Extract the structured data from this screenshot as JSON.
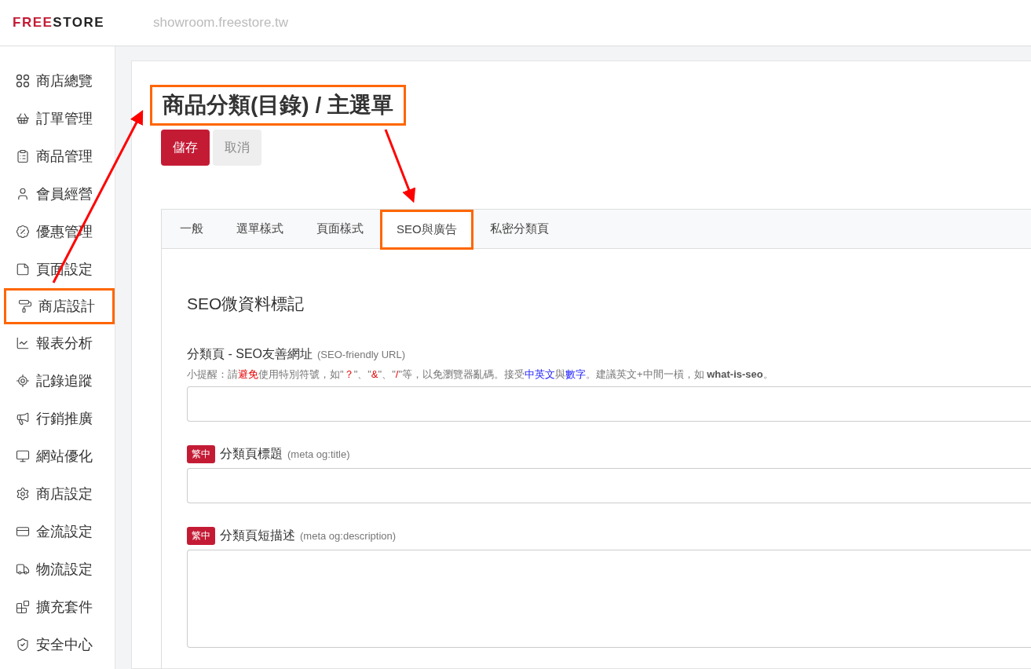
{
  "header": {
    "logo_red": "FREE",
    "logo_dark": "STORE",
    "domain": "showroom.freestore.tw"
  },
  "sidebar": {
    "items": [
      {
        "label": "商店總覽",
        "selected": false,
        "highlighted": false
      },
      {
        "label": "訂單管理",
        "selected": false,
        "highlighted": false
      },
      {
        "label": "商品管理",
        "selected": false,
        "highlighted": false
      },
      {
        "label": "會員經營",
        "selected": false,
        "highlighted": false
      },
      {
        "label": "優惠管理",
        "selected": false,
        "highlighted": false
      },
      {
        "label": "頁面設定",
        "selected": false,
        "highlighted": false
      },
      {
        "label": "商店設計",
        "selected": false,
        "highlighted": true
      },
      {
        "label": "報表分析",
        "selected": false,
        "highlighted": false
      },
      {
        "label": "記錄追蹤",
        "selected": false,
        "highlighted": false
      },
      {
        "label": "行銷推廣",
        "selected": false,
        "highlighted": false
      },
      {
        "label": "網站優化",
        "selected": false,
        "highlighted": false
      },
      {
        "label": "商店設定",
        "selected": false,
        "highlighted": false
      },
      {
        "label": "金流設定",
        "selected": false,
        "highlighted": false
      },
      {
        "label": "物流設定",
        "selected": false,
        "highlighted": false
      },
      {
        "label": "擴充套件",
        "selected": false,
        "highlighted": false
      },
      {
        "label": "安全中心",
        "selected": false,
        "highlighted": false
      }
    ]
  },
  "page": {
    "title": "商品分類(目錄) / 主選單",
    "title_highlighted": true,
    "buttons": [
      {
        "label": "儲存",
        "kind": "primary"
      },
      {
        "label": "取消",
        "kind": "secondary"
      }
    ],
    "tabs": [
      {
        "label": "一般",
        "selected": false,
        "highlighted": false
      },
      {
        "label": "選單樣式",
        "selected": false,
        "highlighted": false
      },
      {
        "label": "頁面樣式",
        "selected": false,
        "highlighted": false
      },
      {
        "label": "SEO與廣告",
        "selected": true,
        "highlighted": true
      },
      {
        "label": "私密分類頁",
        "selected": false,
        "highlighted": false
      }
    ],
    "section_title": "SEO微資料標記",
    "fields": [
      {
        "kind": "input",
        "label": "分類頁 - SEO友善網址",
        "note": "(SEO-friendly URL)",
        "hint": [
          {
            "kind": "plain",
            "text": "小提醒：請"
          },
          {
            "kind": "warn",
            "text": "避免"
          },
          {
            "kind": "plain",
            "text": "使用特別符號，如\""
          },
          {
            "kind": "warn",
            "text": "？"
          },
          {
            "kind": "plain",
            "text": "\"、\""
          },
          {
            "kind": "warn",
            "text": "&"
          },
          {
            "kind": "plain",
            "text": "\"、\""
          },
          {
            "kind": "warn",
            "text": "/"
          },
          {
            "kind": "plain",
            "text": "\"等，以免瀏覽器亂碼。接受"
          },
          {
            "kind": "accept",
            "text": "中英文"
          },
          {
            "kind": "plain",
            "text": "與"
          },
          {
            "kind": "accept",
            "text": "數字"
          },
          {
            "kind": "plain",
            "text": "。建議英文+中間一槓，如 "
          },
          {
            "kind": "bold",
            "text": "what-is-seo"
          },
          {
            "kind": "plain",
            "text": "。"
          }
        ]
      },
      {
        "kind": "input",
        "badge": "繁中",
        "label": "分類頁標題",
        "note": "(meta og:title)"
      },
      {
        "kind": "textarea",
        "badge": "繁中",
        "label": "分類頁短描述",
        "note": "(meta og:description)"
      }
    ]
  }
}
